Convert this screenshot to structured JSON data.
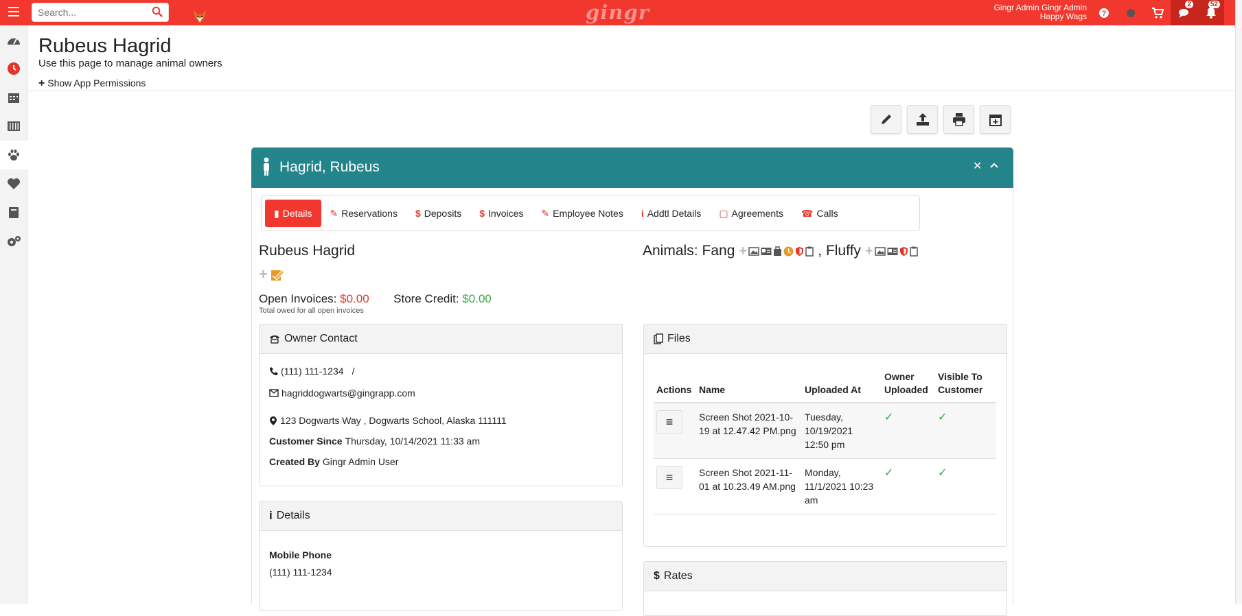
{
  "topbar": {
    "search_placeholder": "Search...",
    "logo": "gingr",
    "user_name": "Gingr Admin Gingr Admin",
    "location": "Happy Wags",
    "chat_badge": "2",
    "notify_badge": "52",
    "accent": "#f2382e"
  },
  "header": {
    "title": "Rubeus Hagrid",
    "subtitle": "Use this page to manage animal owners",
    "permissions_link": "Show App Permissions"
  },
  "panel": {
    "name": "Hagrid, Rubeus",
    "header_color": "#23848a",
    "tabs": [
      {
        "label": "Details",
        "icon": "person-icon",
        "glyph": "▮"
      },
      {
        "label": "Reservations",
        "icon": "edit-icon",
        "glyph": "✎"
      },
      {
        "label": "Deposits",
        "icon": "dollar-icon",
        "glyph": "$"
      },
      {
        "label": "Invoices",
        "icon": "dollar-icon",
        "glyph": "$"
      },
      {
        "label": "Employee Notes",
        "icon": "pencil-icon",
        "glyph": "✎"
      },
      {
        "label": "Addtl Details",
        "icon": "info-icon",
        "glyph": "i"
      },
      {
        "label": "Agreements",
        "icon": "clipboard-icon",
        "glyph": "▢"
      },
      {
        "label": "Calls",
        "icon": "phone-icon",
        "glyph": "☎"
      }
    ]
  },
  "owner": {
    "full_name": "Rubeus Hagrid",
    "open_invoices_label": "Open Invoices:",
    "open_invoices_value": "$0.00",
    "store_credit_label": "Store Credit:",
    "store_credit_value": "$0.00",
    "invoice_note": "Total owed for all open invoices"
  },
  "animals": {
    "label": "Animals:",
    "list": [
      "Fang",
      "Fluffy"
    ],
    "separator": ","
  },
  "contact": {
    "title": "Owner Contact",
    "phone": "(111) 111-1234",
    "phone_sep": "/",
    "email": "hagriddogwarts@gingrapp.com",
    "address": "123 Dogwarts Way , Dogwarts School, Alaska 111111",
    "customer_since_label": "Customer Since",
    "customer_since": "Thursday, 10/14/2021 11:33 am",
    "created_by_label": "Created By",
    "created_by": "Gingr Admin User"
  },
  "details": {
    "title": "Details",
    "mobile_label": "Mobile Phone",
    "mobile_value": "(111) 111-1234"
  },
  "files": {
    "title": "Files",
    "headers": [
      "Actions",
      "Name",
      "Uploaded At",
      "Owner Uploaded",
      "Visible To Customer"
    ],
    "rows": [
      {
        "name": "Screen Shot 2021-10-19 at 12.47.42 PM.png",
        "uploaded": "Tuesday, 10/19/2021 12:50 pm"
      },
      {
        "name": "Screen Shot 2021-11-01 at 10.23.49 AM.png",
        "uploaded": "Monday, 11/1/2021 10:23 am"
      }
    ]
  },
  "rates": {
    "title": "Rates"
  }
}
